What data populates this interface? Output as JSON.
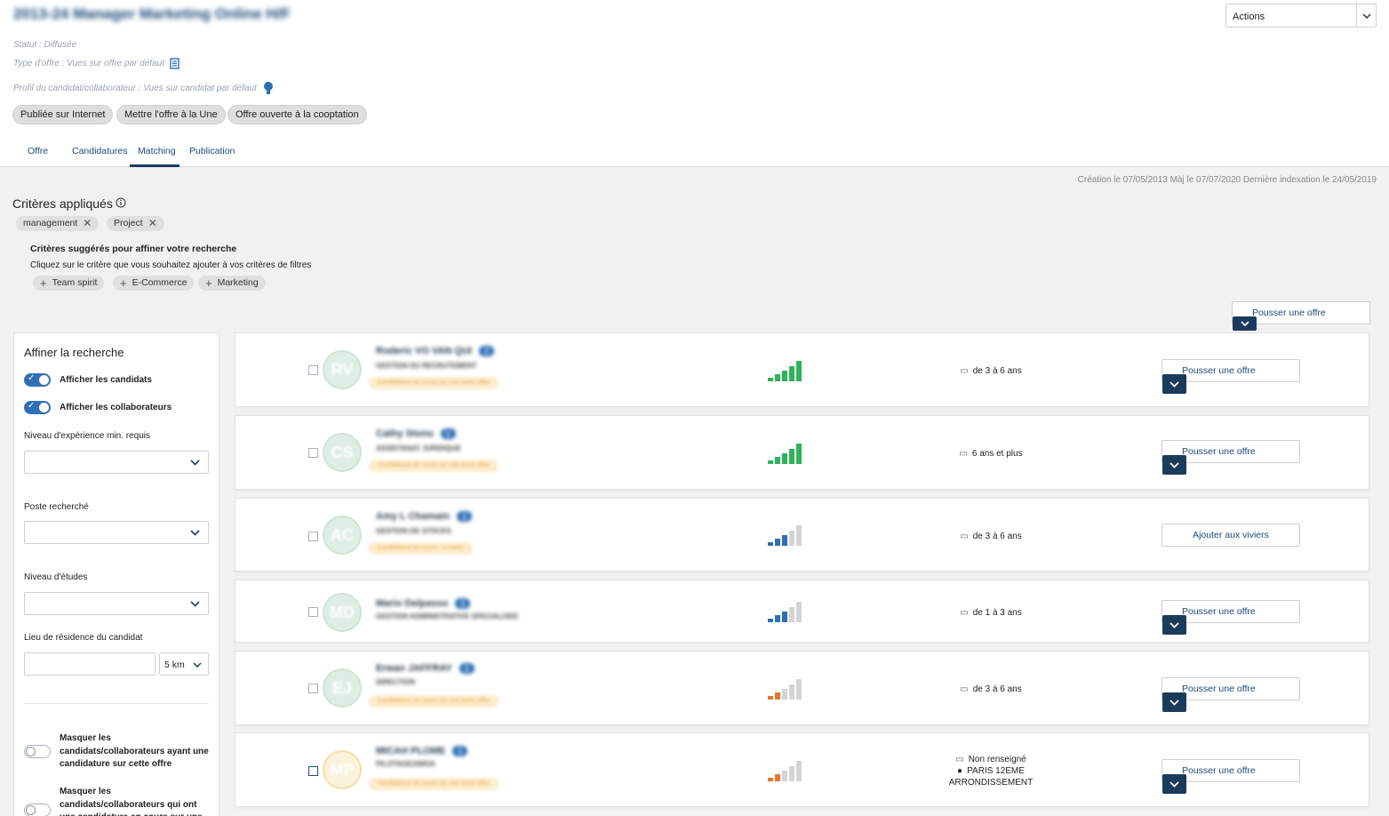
{
  "header": {
    "job_title": "2013-24 Manager Marketing Online H/F",
    "status": "Statut : Diffusée",
    "offer_type": "Type d'offre : Vues sur offre par défaut",
    "profile": "Profil du candidat/collaborateur : Vues sur candidat par défaut",
    "actions_label": "Actions",
    "pills": [
      "Publiée sur Internet",
      "Mettre l'offre à la Une",
      "Offre ouverte à la cooptation"
    ],
    "tabs": [
      "Offre",
      "Candidatures",
      "Matching",
      "Publication"
    ],
    "active_tab": "Matching",
    "timestamps": "Création le 07/05/2013 Màj le 07/07/2020 Dernière indexation le 24/05/2019"
  },
  "criteria": {
    "title": "Critères appliqués",
    "applied": [
      "management",
      "Project"
    ],
    "suggest_title": "Critères suggérés pour affiner votre recherche",
    "suggest_sub": "Cliquez sur le critère que vous souhaitez ajouter à vos critères de filtres",
    "suggested": [
      "Team spirit",
      "E-Commerce",
      "Marketing"
    ]
  },
  "top_push_label": "Pousser une offre",
  "sidebar": {
    "title": "Affiner la recherche",
    "toggle_candidates": "Afficher les candidats",
    "toggle_collaborators": "Afficher les collaborateurs",
    "experience_label": "Niveau d'expérience min. requis",
    "position_label": "Poste recherché",
    "education_label": "Niveau d'études",
    "residence_label": "Lieu de résidence du candidat",
    "distance_value": "5 km",
    "mask1": "Masquer les candidats/collaborateurs ayant une candidature sur cette offre",
    "mask2": "Masquer les candidats/collaborateurs qui ont une candidature en cours sur une"
  },
  "candidates": [
    {
      "initials": "RV",
      "name": "Roderic VO VAN QUI",
      "count": "1",
      "role": "GESTION DU RECRUTEMENT",
      "status": "Candidature en cours sur une autre offre",
      "level": 5,
      "color": "#2eb35a",
      "experience": "de 3 à 6 ans",
      "action": "Pousser une offre"
    },
    {
      "initials": "CS",
      "name": "Cathy Stono",
      "count": "1",
      "role": "ASSISTANAT JURIDIQUE",
      "status": "Candidature en cours sur une autre offre",
      "level": 5,
      "color": "#2eb35a",
      "experience": "6 ans et plus",
      "action": "Pousser une offre"
    },
    {
      "initials": "AC",
      "name": "Amy L Chamain",
      "count": "1",
      "role": "GESTION DE STOCKS",
      "status": "Candidature en cours - à traiter",
      "level": 3,
      "color": "#2f6fb5",
      "experience": "de 3 à 6 ans",
      "action": "Ajouter aux viviers"
    },
    {
      "initials": "MD",
      "name": "Mario Delpasso",
      "count": "1",
      "role": "GESTION ADMINISTRATIVE SPECIALISEE",
      "status": "",
      "level": 3,
      "color": "#2f6fb5",
      "experience": "de 1 à 3 ans",
      "action": "Pousser une offre"
    },
    {
      "initials": "EJ",
      "name": "Erwan JAFFRAY",
      "count": "1",
      "role": "DIRECTION",
      "status": "Candidature en cours sur une autre offre",
      "level": 2,
      "color": "#e8762c",
      "experience": "de 3 à 6 ans",
      "action": "Pousser une offre"
    },
    {
      "initials": "MP",
      "name": "MICAH PLOME",
      "count": "1",
      "role": "PILOTAGE/AMOA",
      "status": "Candidature en cours sur une autre offre",
      "level": 2,
      "color": "#e8762c",
      "experience": "Non renseigné",
      "location": "PARIS 12EME ARRONDISSEMENT",
      "action": "Pousser une offre"
    }
  ]
}
